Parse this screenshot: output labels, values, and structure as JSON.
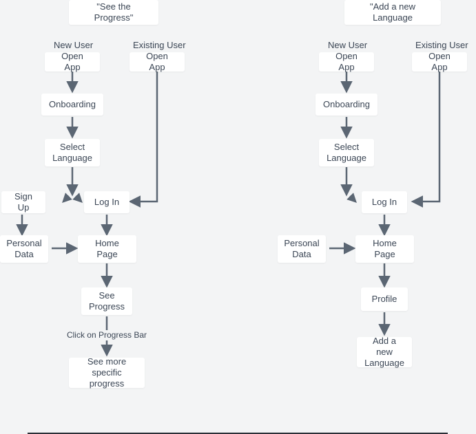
{
  "left": {
    "title": "\"See the Progress\"",
    "newUserLabel": "New User",
    "existingUserLabel": "Existing User",
    "nodes": {
      "openAppNew": "Open App",
      "openAppExisting": "Open App",
      "onboarding": "Onboarding",
      "selectLanguage": "Select Language",
      "signUp": "Sign Up",
      "logIn": "Log In",
      "personalData": "Personal Data",
      "homePage": "Home Page",
      "seeProgress": "See Progress",
      "clickProgressBar": "Click on Progress Bar",
      "seeMoreSpecific": "See more specific progress"
    }
  },
  "right": {
    "title": "\"Add a new Language",
    "newUserLabel": "New User",
    "existingUserLabel": "Existing User",
    "nodes": {
      "openAppNew": "Open App",
      "openAppExisting": "Open App",
      "onboarding": "Onboarding",
      "selectLanguage": "Select Language",
      "logIn": "Log In",
      "personalData": "Personal Data",
      "homePage": "Home Page",
      "profile": "Profile",
      "addLanguage": "Add a new Language"
    }
  },
  "colors": {
    "edge": "#5b6673",
    "bg": "#f3f4f5",
    "node": "#ffffff",
    "text": "#3a4554"
  }
}
